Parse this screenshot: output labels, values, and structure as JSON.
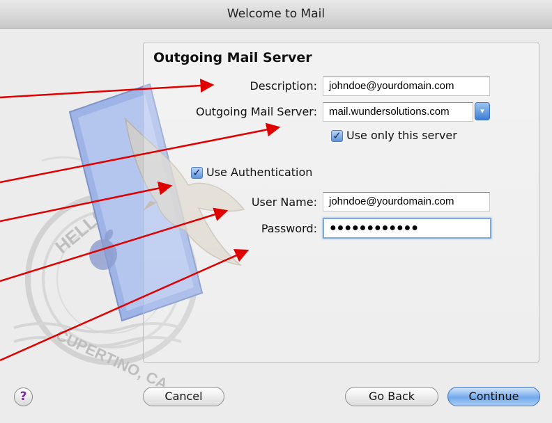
{
  "window": {
    "title": "Welcome to Mail"
  },
  "section": {
    "heading": "Outgoing Mail Server"
  },
  "form": {
    "description_label": "Description:",
    "description_value": "johndoe@yourdomain.com",
    "server_label": "Outgoing Mail Server:",
    "server_value": "mail.wundersolutions.com",
    "use_only_label": "Use only this server",
    "use_only_checked": true,
    "use_auth_label": "Use Authentication",
    "use_auth_checked": true,
    "username_label": "User Name:",
    "username_value": "johndoe@yourdomain.com",
    "password_label": "Password:",
    "password_mask": "●●●●●●●●●●●●"
  },
  "buttons": {
    "help": "?",
    "cancel": "Cancel",
    "go_back": "Go Back",
    "continue": "Continue"
  },
  "stamp": {
    "text_top": "HELLO FR",
    "text_bottom": "CUPERTINO, CA"
  },
  "colors": {
    "accent": "#3d7fd3",
    "annotation_arrow": "#e00000"
  },
  "icons": {
    "help": "question-mark-icon",
    "popup": "popup-arrow-icon",
    "checkbox": "checkmark-icon"
  }
}
